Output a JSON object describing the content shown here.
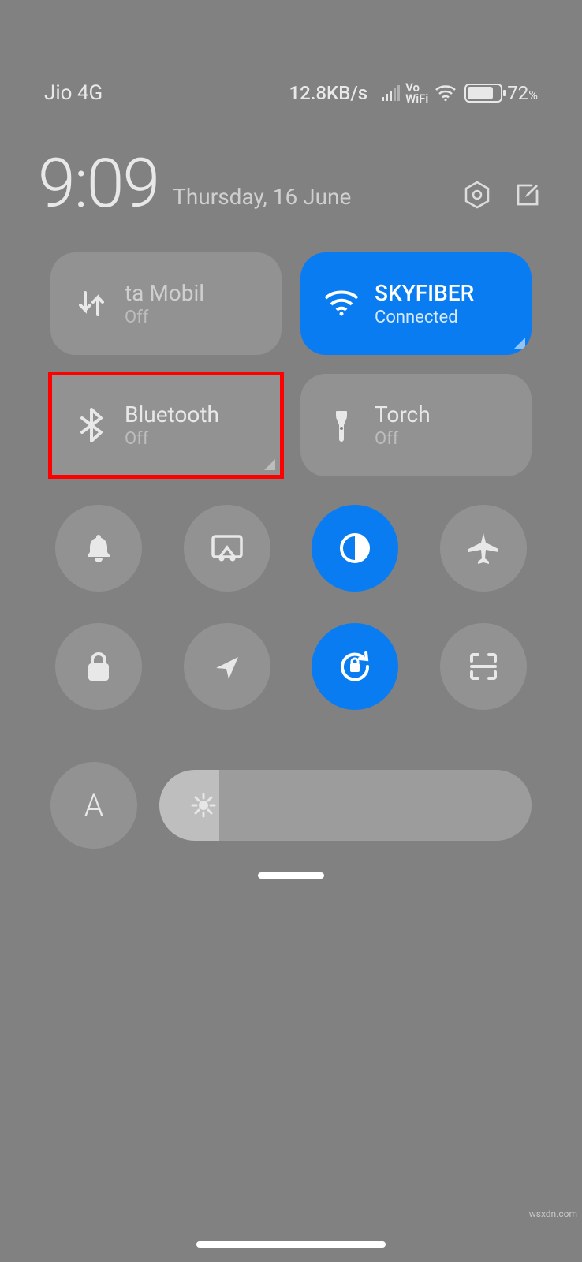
{
  "statusbar": {
    "carrier": "Jio 4G",
    "netspeed": "12.8KB/s",
    "vowifi_top": "Vo",
    "vowifi_bottom": "WiFi",
    "battery_pct_int": "72",
    "battery_fill_pct": 72
  },
  "clock": {
    "time": "9:09",
    "date": "Thursday, 16 June"
  },
  "tiles": [
    {
      "title": "ta     Mobil",
      "sub": "Off"
    },
    {
      "title": "SKYFIBER",
      "sub": "Connected"
    },
    {
      "title": "Bluetooth",
      "sub": "Off"
    },
    {
      "title": "Torch",
      "sub": "Off"
    }
  ],
  "round_tiles": {
    "auto_label": "A"
  },
  "brightness": {
    "value_pct": 16
  },
  "colors": {
    "accent": "#0a7cf2",
    "highlight": "#ff0000"
  },
  "watermark": "wsxdn.com"
}
